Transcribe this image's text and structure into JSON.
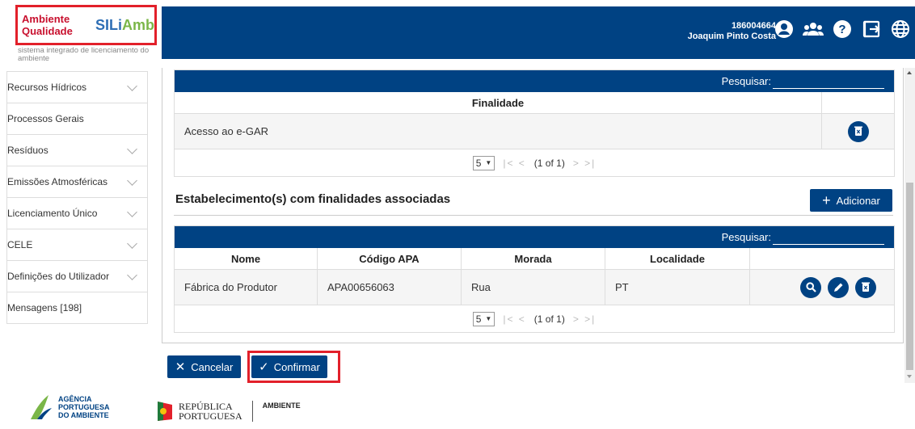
{
  "header": {
    "logo_line1": "Ambiente",
    "logo_line2": "Qualidade",
    "logo_brand_a": "SILi",
    "logo_brand_b": "Amb",
    "logo_subtitle": "sistema integrado de licenciamento do ambiente",
    "user_id": "186004664",
    "user_name": "Joaquim Pinto Costa",
    "icons": [
      "user-circle-icon",
      "group-icon",
      "help-icon",
      "logout-icon",
      "globe-icon"
    ]
  },
  "sidebar": {
    "items": [
      {
        "label": "Recursos Hídricos",
        "chevron": true
      },
      {
        "label": "Processos Gerais",
        "chevron": false
      },
      {
        "label": "Resíduos",
        "chevron": true
      },
      {
        "label": "Emissões Atmosféricas",
        "chevron": true
      },
      {
        "label": "Licenciamento Único",
        "chevron": true
      },
      {
        "label": "CELE",
        "chevron": true
      },
      {
        "label": "Definições do Utilizador",
        "chevron": true
      },
      {
        "label": "Mensagens [198]",
        "chevron": false
      }
    ]
  },
  "table1": {
    "search_label": "Pesquisar:",
    "columns": [
      "Finalidade",
      ""
    ],
    "rows": [
      {
        "finalidade": "Acesso ao e-GAR"
      }
    ],
    "pager": {
      "page_size": "5",
      "info": "(1 of 1)"
    }
  },
  "section": {
    "title": "Estabelecimento(s) com finalidades associadas",
    "add_label": "Adicionar"
  },
  "table2": {
    "search_label": "Pesquisar:",
    "columns": [
      "Nome",
      "Código APA",
      "Morada",
      "Localidade",
      ""
    ],
    "rows": [
      {
        "nome": "Fábrica do Produtor",
        "codigo": "APA00656063",
        "morada": "Rua",
        "localidade": "PT"
      }
    ],
    "pager": {
      "page_size": "5",
      "info": "(1 of 1)"
    }
  },
  "actions": {
    "cancel_label": "Cancelar",
    "confirm_label": "Confirmar"
  },
  "footer": {
    "apa_line1": "AGÊNCIA",
    "apa_line2": "PORTUGUESA",
    "apa_line3": "DO AMBIENTE",
    "rep_line1": "REPÚBLICA",
    "rep_line2": "PORTUGUESA",
    "ambiente": "AMBIENTE"
  },
  "colors": {
    "primary": "#004283",
    "highlight": "#e2202a"
  }
}
